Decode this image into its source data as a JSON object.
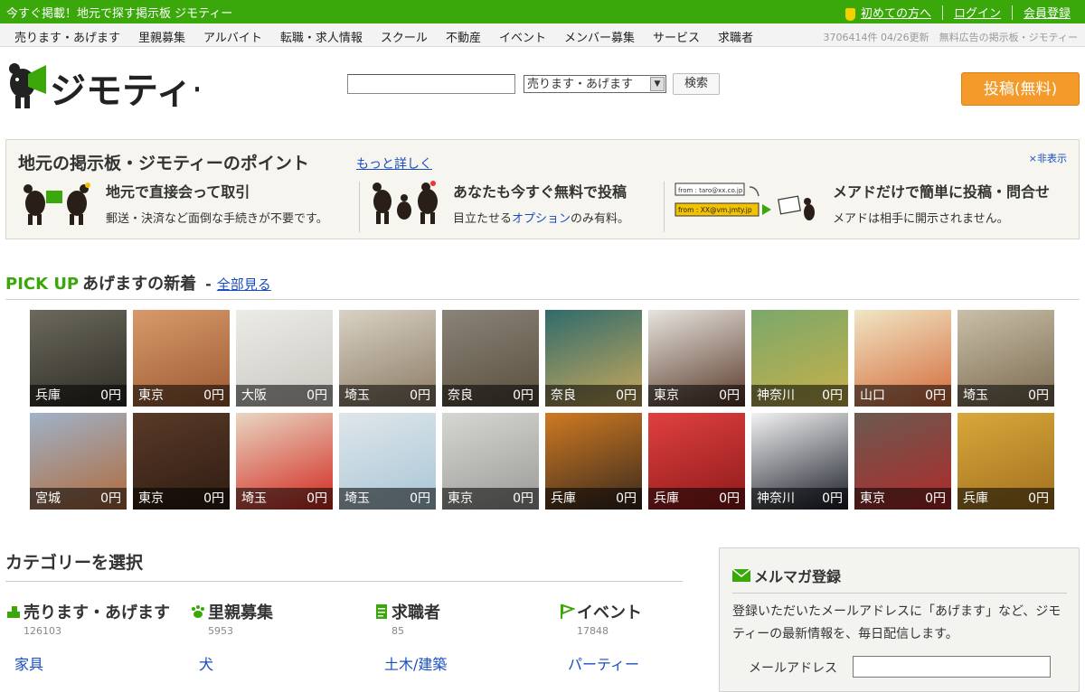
{
  "topbar": {
    "tagline": "今すぐ掲載！地元で探す掲示板 ジモティー",
    "links": [
      "初めての方へ",
      "ログイン",
      "会員登録"
    ]
  },
  "nav": {
    "items": [
      "売ります・あげます",
      "里親募集",
      "アルバイト",
      "転職・求人情報",
      "スクール",
      "不動産",
      "イベント",
      "メンバー募集",
      "サービス",
      "求職者"
    ],
    "info": "3706414件 04/26更新　無料広告の掲示板・ジモティー"
  },
  "logo": {
    "text": "ジモティー"
  },
  "search": {
    "input_value": "",
    "select_value": "売ります・あげます",
    "button": "検索"
  },
  "post_button": "投稿(無料)",
  "point": {
    "title": "地元の掲示板・ジモティーのポイント",
    "more": "もっと詳しく",
    "hide": "×非表示",
    "features": [
      {
        "title": "地元で直接会って取引",
        "desc": "郵送・決済など面倒な手続きが不要です。"
      },
      {
        "title": "あなたも今すぐ無料で投稿",
        "desc_pre": "目立たせる",
        "desc_link": "オプション",
        "desc_post": "のみ有料。"
      },
      {
        "title": "メアドだけで簡単に投稿・問合せ",
        "desc": "メアドは相手に開示されません。",
        "mail_from_1": "from : taro@xx.co.jp",
        "mail_from_2": "from : XX@vm.jmty.jp"
      }
    ]
  },
  "pickup": {
    "label": "PICK UP",
    "title": "あげますの新着",
    "dash": "-",
    "all": "全部見る",
    "items": [
      {
        "area": "兵庫",
        "price": "0円",
        "colors": [
          "#6b6a5c",
          "#2f2c25"
        ]
      },
      {
        "area": "東京",
        "price": "0円",
        "colors": [
          "#d89a6a",
          "#9c5a32"
        ]
      },
      {
        "area": "大阪",
        "price": "0円",
        "colors": [
          "#ecebe6",
          "#c9c7c0"
        ]
      },
      {
        "area": "埼玉",
        "price": "0円",
        "colors": [
          "#d9d2c4",
          "#8a7a64"
        ]
      },
      {
        "area": "奈良",
        "price": "0円",
        "colors": [
          "#8a8378",
          "#5a4f3e"
        ]
      },
      {
        "area": "奈良",
        "price": "0円",
        "colors": [
          "#2f6b6d",
          "#caa95a"
        ]
      },
      {
        "area": "東京",
        "price": "0円",
        "colors": [
          "#e7e4df",
          "#5a3a2a"
        ]
      },
      {
        "area": "神奈川",
        "price": "0円",
        "colors": [
          "#7aa86a",
          "#c8b04a"
        ]
      },
      {
        "area": "山口",
        "price": "0円",
        "colors": [
          "#f0e6c4",
          "#d46a3a"
        ]
      },
      {
        "area": "埼玉",
        "price": "0円",
        "colors": [
          "#c9bfa8",
          "#7a6a50"
        ]
      },
      {
        "area": "宮城",
        "price": "0円",
        "colors": [
          "#9fb2c9",
          "#b06a3a"
        ]
      },
      {
        "area": "東京",
        "price": "0円",
        "colors": [
          "#5a3a28",
          "#2e1c12"
        ]
      },
      {
        "area": "埼玉",
        "price": "0円",
        "colors": [
          "#e8d6c2",
          "#d2281e"
        ]
      },
      {
        "area": "埼玉",
        "price": "0円",
        "colors": [
          "#dfe6ea",
          "#a8c6d6"
        ]
      },
      {
        "area": "東京",
        "price": "0円",
        "colors": [
          "#d6d6d2",
          "#9a9a96"
        ]
      },
      {
        "area": "兵庫",
        "price": "0円",
        "colors": [
          "#cf7a22",
          "#3a2a1e"
        ]
      },
      {
        "area": "兵庫",
        "price": "0円",
        "colors": [
          "#e04040",
          "#8e1a1a"
        ]
      },
      {
        "area": "神奈川",
        "price": "0円",
        "colors": [
          "#f2f2f2",
          "#1c1f2a"
        ]
      },
      {
        "area": "東京",
        "price": "0円",
        "colors": [
          "#6a5a50",
          "#b02a2a"
        ]
      },
      {
        "area": "兵庫",
        "price": "0円",
        "colors": [
          "#d8a83a",
          "#a27020"
        ]
      }
    ]
  },
  "categories": {
    "heading": "カテゴリーを選択",
    "items": [
      {
        "name": "売ります・あげます",
        "count": "126103",
        "first": "家具",
        "icon": "hand-give-icon"
      },
      {
        "name": "里親募集",
        "count": "5953",
        "first": "犬",
        "icon": "paw-icon"
      },
      {
        "name": "求職者",
        "count": "85",
        "first": "土木/建築",
        "icon": "document-icon"
      },
      {
        "name": "イベント",
        "count": "17848",
        "first": "パーティー",
        "icon": "flag-icon"
      }
    ]
  },
  "mailmag": {
    "title": "メルマガ登録",
    "desc": "登録いただいたメールアドレスに「あげます」など、ジモティーの最新情報を、毎日配信します。",
    "label": "メールアドレス",
    "input_value": ""
  },
  "colors": {
    "brand_green": "#3aa70a",
    "accent_orange": "#f39a2a",
    "link_blue": "#1a4dbf"
  }
}
